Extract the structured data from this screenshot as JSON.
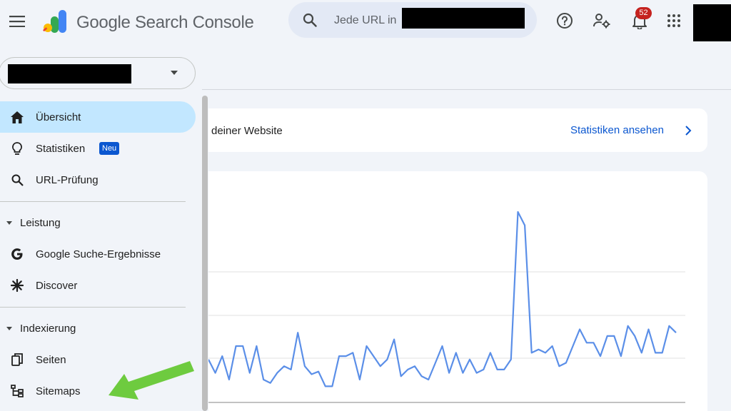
{
  "header": {
    "brand": "Google Search Console",
    "search_placeholder": "Jede URL in",
    "notification_count": "52",
    "icons": [
      "menu-icon",
      "help-icon",
      "manage-accounts-icon",
      "notifications-icon",
      "apps-grid-icon"
    ]
  },
  "sidebar": {
    "items": [
      {
        "label": "Übersicht",
        "icon": "home-icon",
        "active": true
      },
      {
        "label": "Statistiken",
        "icon": "lightbulb-icon",
        "badge": "Neu"
      },
      {
        "label": "URL-Prüfung",
        "icon": "search-icon"
      }
    ],
    "sections": [
      {
        "label": "Leistung",
        "items": [
          {
            "label": "Google Suche-Ergebnisse",
            "icon": "google-g-icon"
          },
          {
            "label": "Discover",
            "icon": "asterisk-icon"
          }
        ]
      },
      {
        "label": "Indexierung",
        "items": [
          {
            "label": "Seiten",
            "icon": "pages-copy-icon"
          },
          {
            "label": "Sitemaps",
            "icon": "sitemap-icon"
          }
        ]
      }
    ]
  },
  "main": {
    "insights_text": "deiner Website",
    "insights_link": "Statistiken ansehen"
  },
  "colors": {
    "accent": "#0b57d0",
    "active_nav": "#c2e7ff",
    "line": "#5b8fe8",
    "arrow": "#6ecb3f",
    "badge": "#c5221f"
  },
  "chart_data": {
    "type": "line",
    "series": [
      {
        "values": [
          3,
          1,
          3.5,
          0,
          5,
          5,
          1,
          5,
          0,
          -0.5,
          1,
          2,
          1.5,
          7,
          2,
          0.8,
          1.2,
          -1,
          -1,
          3.5,
          3.5,
          4,
          0,
          5,
          3.5,
          2,
          3,
          6,
          0.5,
          1.5,
          2,
          0.5,
          0,
          2.5,
          5,
          1,
          4,
          1,
          3,
          1,
          1.5,
          4,
          1.5,
          1.5,
          3,
          25,
          23,
          4,
          4.5,
          4,
          5,
          2,
          2.5,
          5,
          7.5,
          5.5,
          5.5,
          3.5,
          6.5,
          6.5,
          3.5,
          8,
          6.5,
          4,
          7.5,
          4,
          4,
          8,
          7
        ]
      }
    ]
  }
}
